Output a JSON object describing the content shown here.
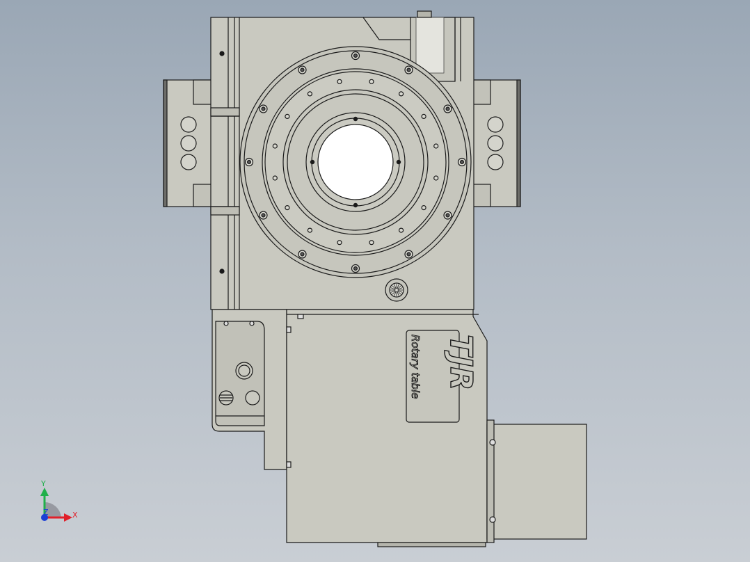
{
  "logo": {
    "brand": "TJR",
    "tagline": "Rotary table"
  },
  "triad": {
    "x": "X",
    "y": "Y",
    "z": "Z"
  },
  "colors": {
    "body": "#c9c9c0",
    "body_dark": "#b8b8ae",
    "edge": "#1a1a1a",
    "flange": "#6d6d69",
    "axis_x": "#e0202a",
    "axis_y": "#1fb04a",
    "axis_z": "#1c3fd6"
  }
}
